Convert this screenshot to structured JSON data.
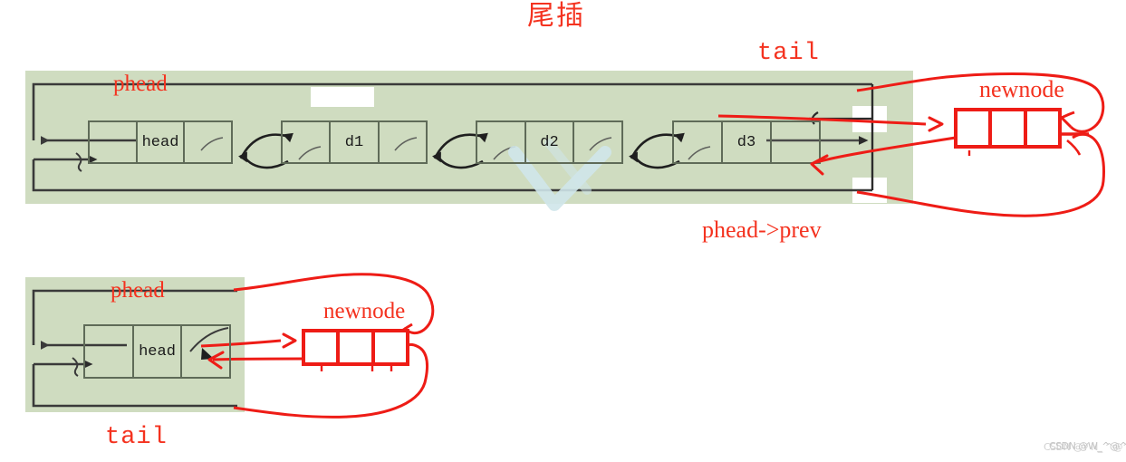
{
  "title": "尾插",
  "colors": {
    "panel_green": "#cfdcc0",
    "annotation_red": "#ee1c16",
    "label_red": "#f4321f",
    "node_border": "#5f6b58",
    "watermark_gray": "#b9b9b9",
    "background": "#ffffff"
  },
  "top_diagram": {
    "labels": {
      "phead": "phead",
      "tail": "tail",
      "phead_prev": "phead->prev",
      "newnode": "newnode"
    },
    "nodes": [
      {
        "name": "head-node",
        "prev": "",
        "data": "head",
        "next": ""
      },
      {
        "name": "d1-node",
        "prev": "",
        "data": "d1",
        "next": ""
      },
      {
        "name": "d2-node",
        "prev": "",
        "data": "d2",
        "next": ""
      },
      {
        "name": "d3-node",
        "prev": "",
        "data": "d3",
        "next": ""
      }
    ],
    "newnode_cells": [
      "",
      "",
      ""
    ]
  },
  "bottom_diagram": {
    "labels": {
      "phead": "phead",
      "tail": "tail",
      "newnode": "newnode"
    },
    "nodes": [
      {
        "name": "head-node",
        "prev": "",
        "data": "head",
        "next": ""
      }
    ],
    "newnode_cells": [
      "",
      "",
      ""
    ]
  },
  "watermark": {
    "line1": "CSDN @W_^@^",
    "line2": "CSDN  @Y  N_ ^@^"
  }
}
